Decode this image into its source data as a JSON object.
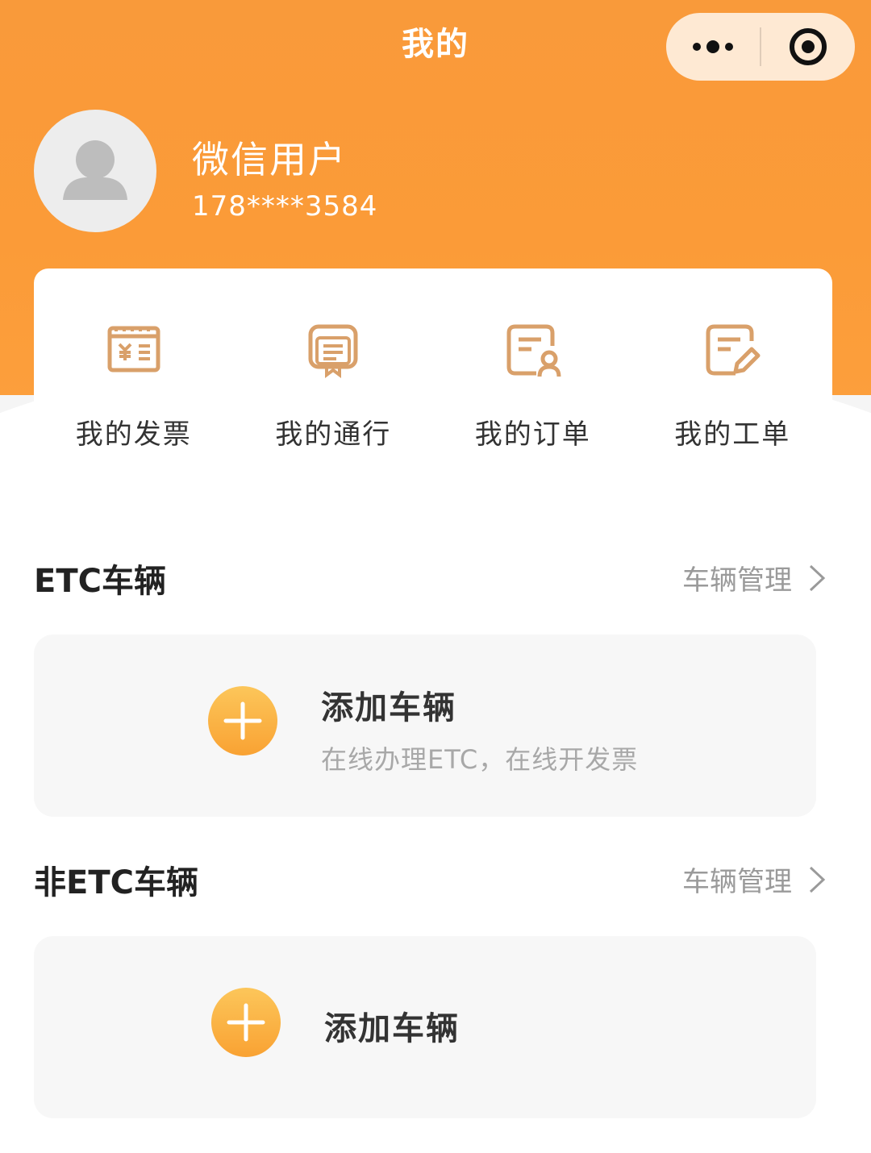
{
  "nav": {
    "title": "我的"
  },
  "user": {
    "name": "微信用户",
    "phone": "178****3584"
  },
  "quick_menu": [
    {
      "label": "我的发票",
      "icon": "invoice-icon"
    },
    {
      "label": "我的通行",
      "icon": "passage-icon"
    },
    {
      "label": "我的订单",
      "icon": "order-icon"
    },
    {
      "label": "我的工单",
      "icon": "work-order-icon"
    }
  ],
  "etc_section": {
    "title": "ETC车辆",
    "manage_label": "车辆管理",
    "card_title": "添加车辆",
    "card_subtitle": "在线办理ETC，在线开发票"
  },
  "non_etc_section": {
    "title": "非ETC车辆",
    "manage_label": "车辆管理",
    "card_title": "添加车辆"
  },
  "colors": {
    "brand_orange": "#fb9b38",
    "icon_tan": "#d9a06a"
  }
}
